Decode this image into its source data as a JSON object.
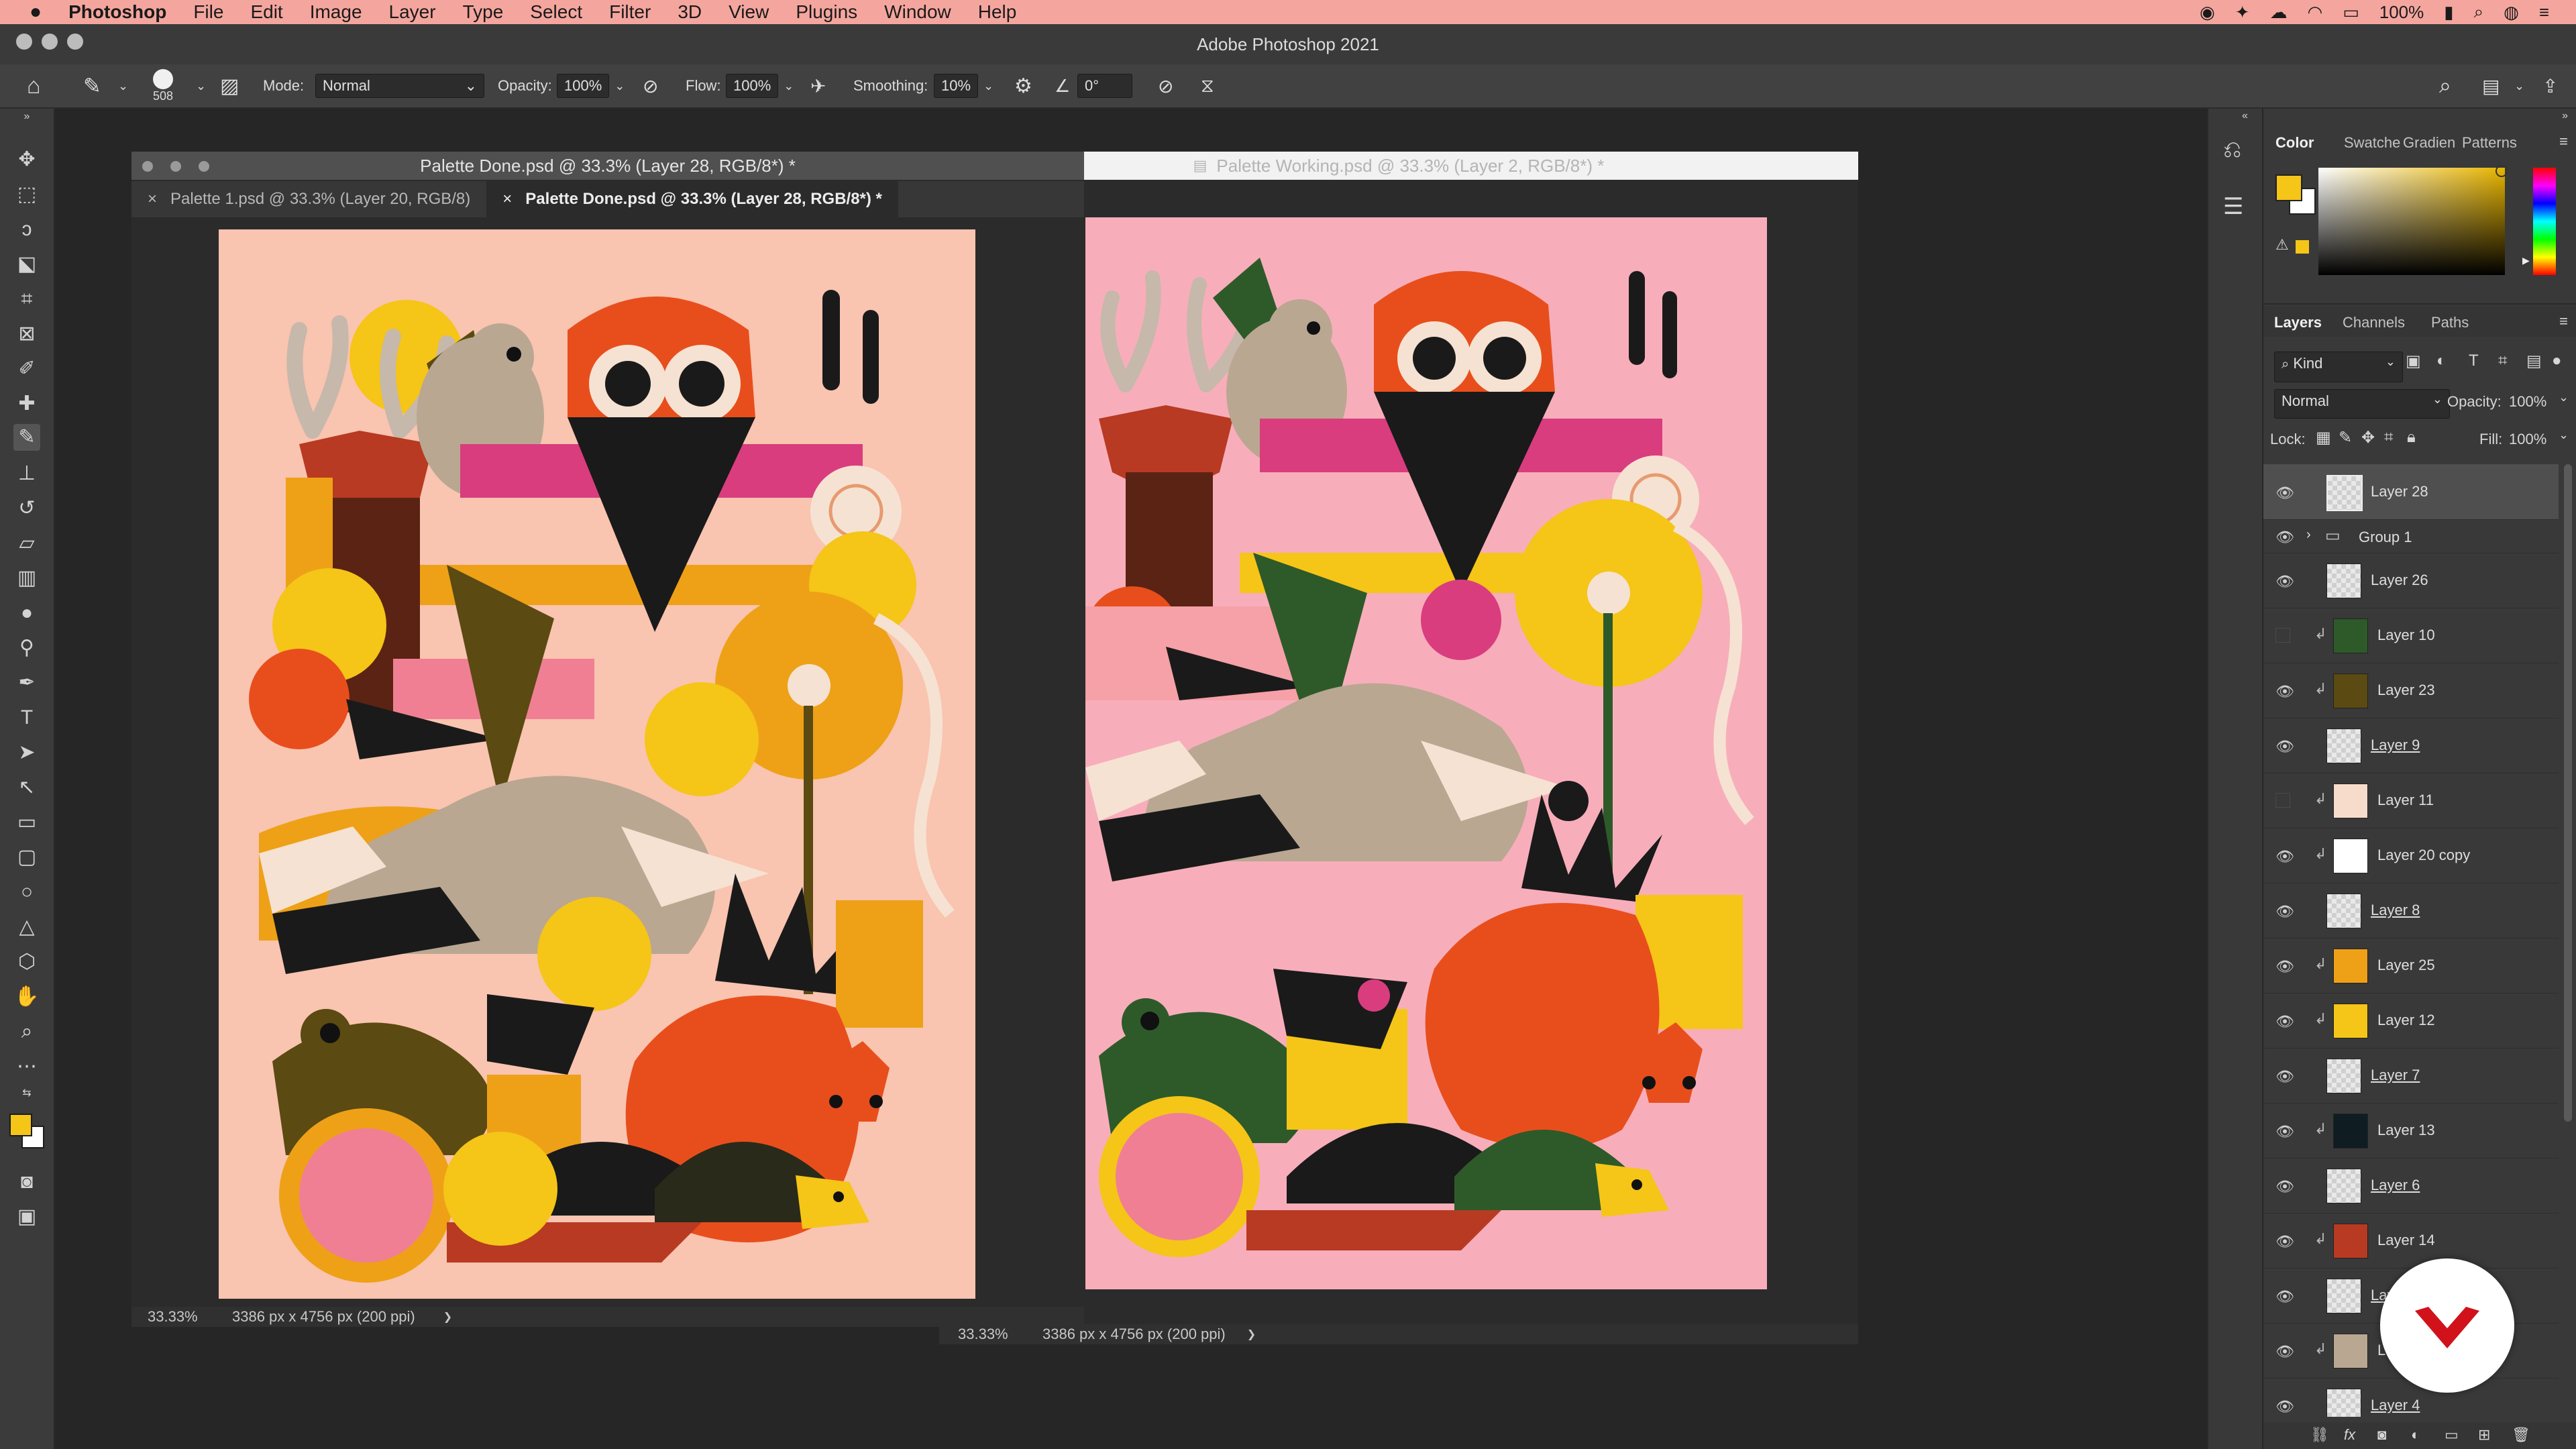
{
  "menubar": {
    "apple": "",
    "app_name": "Photoshop",
    "items": [
      "File",
      "Edit",
      "Image",
      "Layer",
      "Type",
      "Select",
      "Filter",
      "3D",
      "View",
      "Plugins",
      "Window",
      "Help"
    ],
    "battery": "100%"
  },
  "window": {
    "title": "Adobe Photoshop 2021"
  },
  "options": {
    "brush_size": "508",
    "mode_label": "Mode:",
    "mode_value": "Normal",
    "opacity_label": "Opacity:",
    "opacity_value": "100%",
    "flow_label": "Flow:",
    "flow_value": "100%",
    "smoothing_label": "Smoothing:",
    "smoothing_value": "10%",
    "angle_value": "0°"
  },
  "doc_done": {
    "title": "Palette Done.psd @ 33.3% (Layer 28, RGB/8*) *",
    "tabs": [
      {
        "label": "Palette 1.psd @ 33.3% (Layer 20, RGB/8)",
        "close": "×"
      },
      {
        "label": "Palette Done.psd @ 33.3% (Layer 28, RGB/8*) *",
        "close": "×"
      }
    ],
    "zoom": "33.33%",
    "dims": "3386 px x 4756 px (200 ppi)",
    "arrow": "❯"
  },
  "doc_working": {
    "title": "Palette Working.psd @ 33.3% (Layer 2, RGB/8*) *",
    "zoom": "33.33%",
    "dims": "3386 px x 4756 px (200 ppi)",
    "arrow": "❯"
  },
  "colors": {
    "foreground": "#f5c518",
    "background": "#ffffff",
    "done_canvas": "#f9c4b0",
    "working_canvas": "#f7aeba",
    "menubar": "#f4a69e"
  },
  "color_panel": {
    "tabs": [
      "Color",
      "Swatche",
      "Gradien",
      "Patterns"
    ]
  },
  "layers_panel": {
    "tabs": [
      "Layers",
      "Channels",
      "Paths"
    ],
    "kind_label": "Kind",
    "blend_mode": "Normal",
    "opacity_label": "Opacity:",
    "opacity_value": "100%",
    "lock_label": "Lock:",
    "fill_label": "Fill:",
    "fill_value": "100%",
    "layers": [
      {
        "name": "Layer 28",
        "visible": true,
        "clipped": false,
        "thumb": "checker",
        "selected": true
      },
      {
        "name": "Group 1",
        "visible": true,
        "clipped": false,
        "thumb": "folder",
        "selected": false
      },
      {
        "name": "Layer 26",
        "visible": true,
        "clipped": false,
        "thumb": "checker",
        "selected": false
      },
      {
        "name": "Layer 10",
        "visible": false,
        "clipped": true,
        "thumb": "#2e5a2a",
        "selected": false
      },
      {
        "name": "Layer 23",
        "visible": true,
        "clipped": true,
        "thumb": "#5b4a12",
        "selected": false
      },
      {
        "name": "Layer 9",
        "visible": true,
        "clipped": false,
        "thumb": "checker",
        "selected": false
      },
      {
        "name": "Layer 11",
        "visible": false,
        "clipped": true,
        "thumb": "#f8dccb",
        "selected": false
      },
      {
        "name": "Layer 20 copy",
        "visible": true,
        "clipped": true,
        "thumb": "#ffffff",
        "selected": false
      },
      {
        "name": "Layer 8",
        "visible": true,
        "clipped": false,
        "thumb": "checker",
        "selected": false
      },
      {
        "name": "Layer 25",
        "visible": true,
        "clipped": true,
        "thumb": "#eea116",
        "selected": false
      },
      {
        "name": "Layer 12",
        "visible": true,
        "clipped": true,
        "thumb": "#f5c518",
        "selected": false
      },
      {
        "name": "Layer 7",
        "visible": true,
        "clipped": false,
        "thumb": "checker",
        "selected": false
      },
      {
        "name": "Layer 13",
        "visible": true,
        "clipped": true,
        "thumb": "#0f1d22",
        "selected": false
      },
      {
        "name": "Layer 6",
        "visible": true,
        "clipped": false,
        "thumb": "checker",
        "selected": false
      },
      {
        "name": "Layer 14",
        "visible": true,
        "clipped": true,
        "thumb": "#b83a22",
        "selected": false
      },
      {
        "name": "Layer",
        "visible": true,
        "clipped": false,
        "thumb": "checker",
        "selected": false
      },
      {
        "name": "La",
        "visible": true,
        "clipped": true,
        "thumb": "#b9a792",
        "selected": false
      },
      {
        "name": "Layer 4",
        "visible": true,
        "clipped": false,
        "thumb": "checker",
        "selected": false
      }
    ]
  },
  "icons": [
    "home-icon",
    "brush-icon",
    "move-icon",
    "marquee-icon",
    "lasso-icon",
    "crop-icon",
    "eyedropper-icon",
    "eraser-icon",
    "text-icon",
    "zoom-icon",
    "hand-icon",
    "eye-icon",
    "search-icon",
    "folder-icon",
    "lock-icon",
    "fx-icon",
    "trash-icon"
  ]
}
